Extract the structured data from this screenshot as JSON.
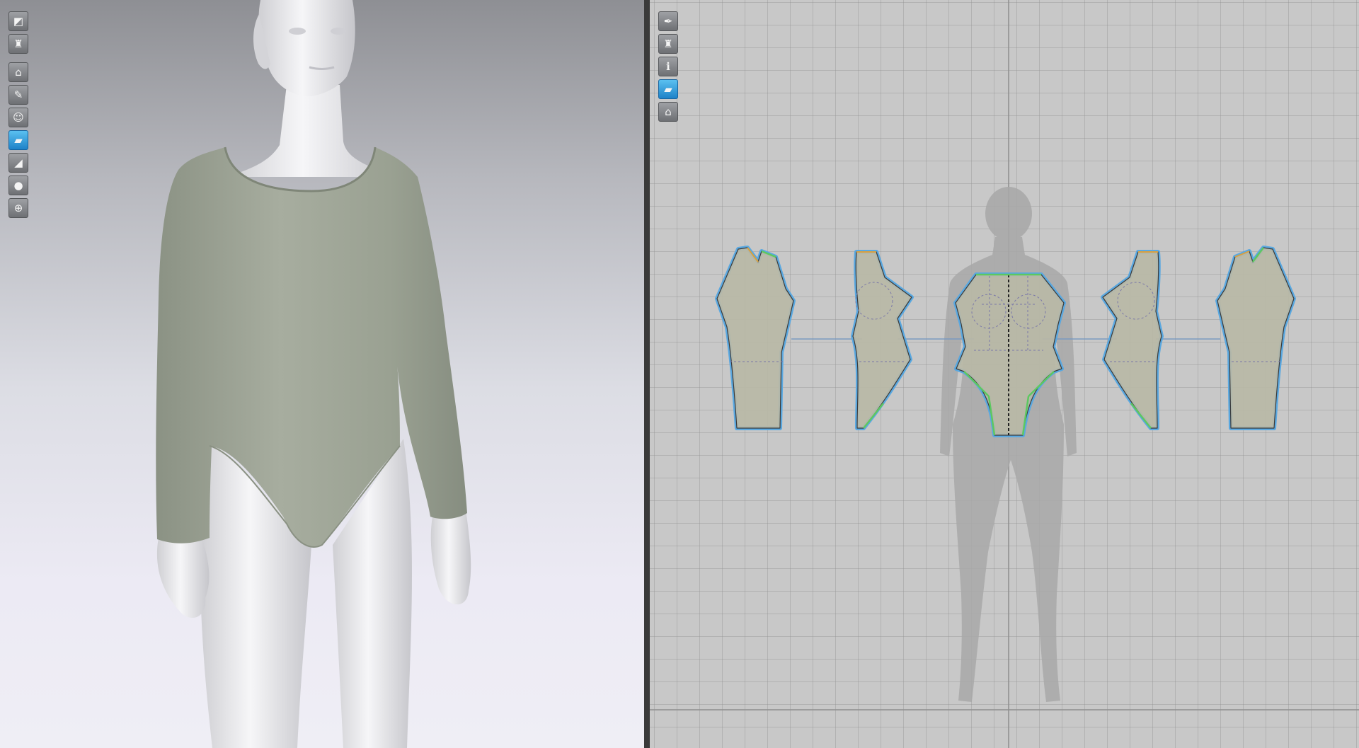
{
  "viewport_3d": {
    "toolbar": [
      {
        "icon": "shading-icon",
        "glyph": "◩",
        "active": false
      },
      {
        "icon": "garment-icon",
        "glyph": "♜",
        "active": false
      },
      {
        "icon": "show-garment-icon",
        "glyph": "⌂",
        "active": false,
        "gap_before": true
      },
      {
        "icon": "texture-icon",
        "glyph": "✎",
        "active": false
      },
      {
        "icon": "show-avatar-icon",
        "glyph": "☺",
        "active": false
      },
      {
        "icon": "fabric-render-icon",
        "glyph": "▰",
        "active": true
      },
      {
        "icon": "thickness-icon",
        "glyph": "◢",
        "active": false
      },
      {
        "icon": "avatar-mode-icon",
        "glyph": "●",
        "active": false
      },
      {
        "icon": "world-grid-icon",
        "glyph": "⊕",
        "active": false
      }
    ],
    "colors": {
      "fabric": "#a3aa9a",
      "avatar": "#e8e8ea"
    }
  },
  "viewport_2d": {
    "toolbar": [
      {
        "icon": "edit-pattern-icon",
        "glyph": "✒",
        "active": false
      },
      {
        "icon": "show-pattern-icon",
        "glyph": "♜",
        "active": false
      },
      {
        "icon": "info-icon",
        "glyph": "ℹ",
        "active": false
      },
      {
        "icon": "fabric-color-icon",
        "glyph": "▰",
        "active": true
      },
      {
        "icon": "lock-pattern-icon",
        "glyph": "⌂",
        "active": false
      }
    ],
    "colors": {
      "pattern_fill": "#b8b9a6",
      "outline": "#5aa8e0",
      "seam_green": "#5dc860",
      "seam_orange": "#d8a040"
    }
  }
}
